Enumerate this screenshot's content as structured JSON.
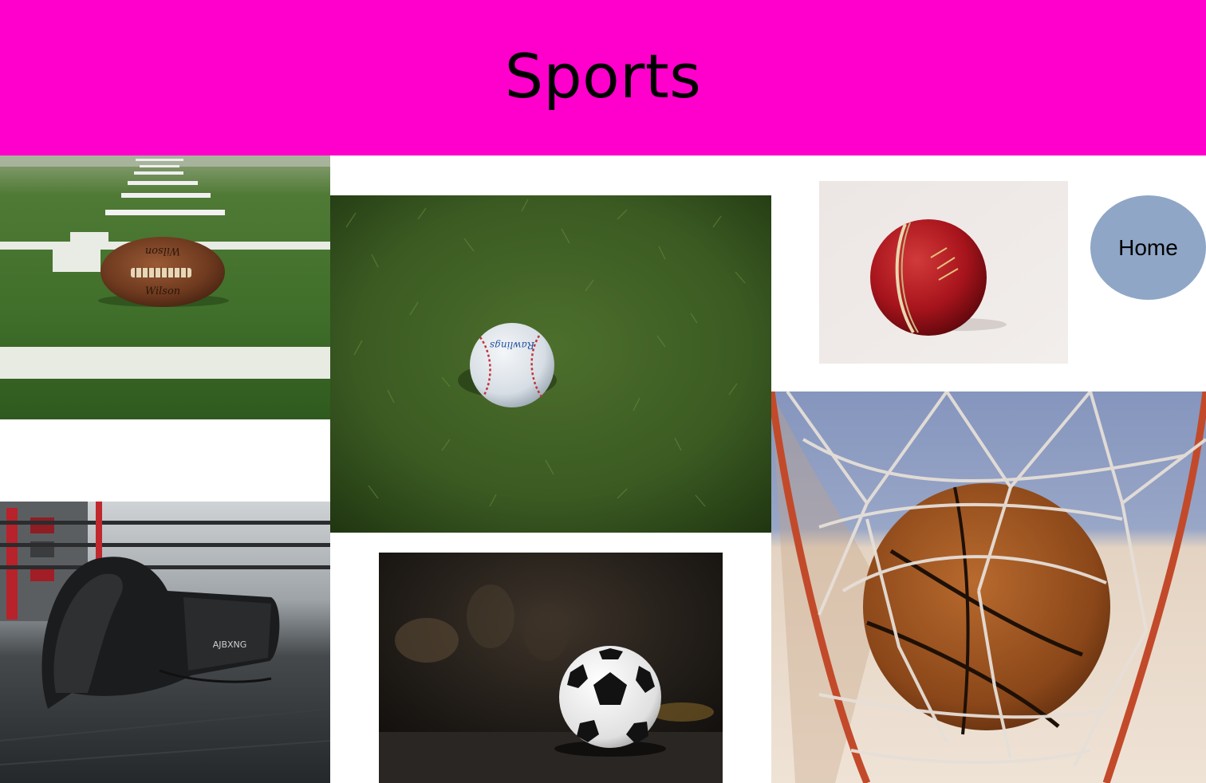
{
  "header": {
    "title": "Sports",
    "background": "#ff00cc"
  },
  "nav": {
    "home_label": "Home",
    "home_color": "#8fa6c6"
  },
  "photos": [
    {
      "name": "american-football-photo",
      "print": "Wilson"
    },
    {
      "name": "baseball-photo",
      "print": "Rawlings"
    },
    {
      "name": "cricket-ball-photo"
    },
    {
      "name": "boxing-glove-photo",
      "print": "AJBXNG"
    },
    {
      "name": "soccer-ball-photo"
    },
    {
      "name": "basketball-hoop-photo"
    }
  ]
}
